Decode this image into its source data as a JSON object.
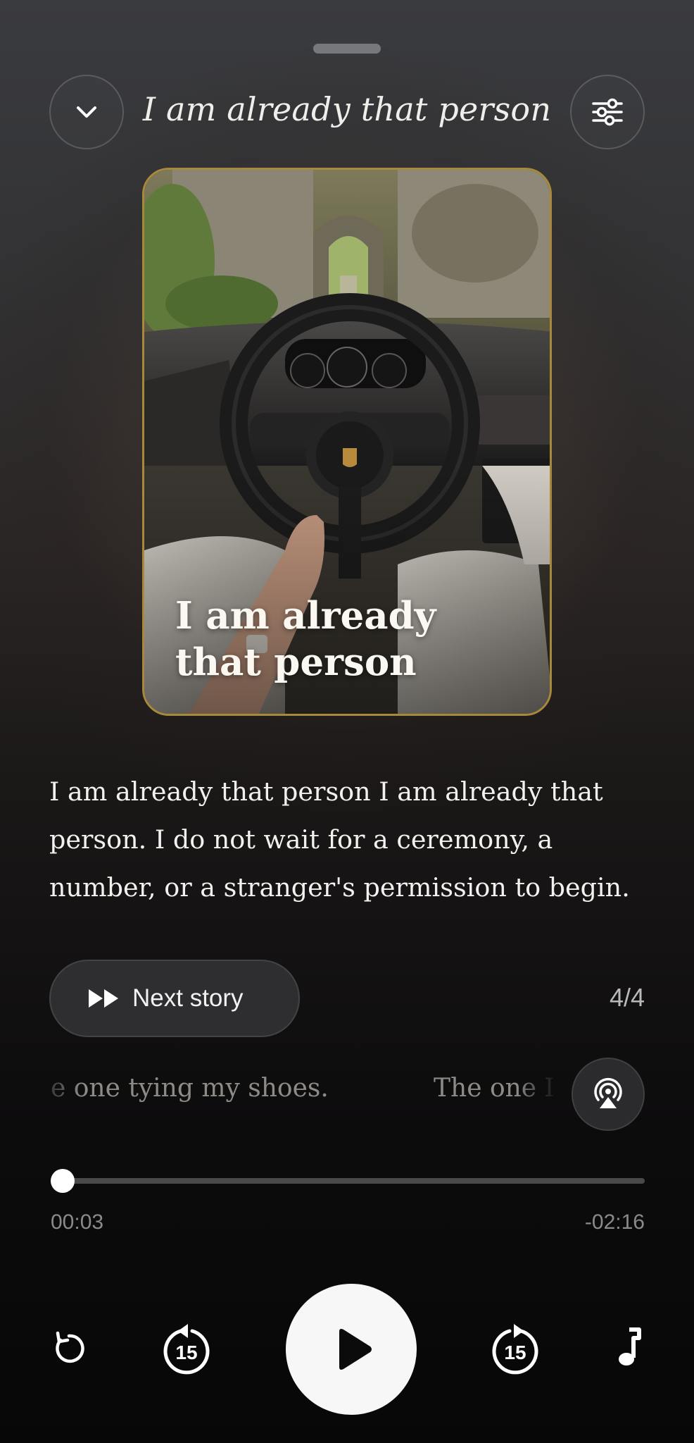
{
  "header": {
    "title": "I am already that person"
  },
  "cover": {
    "title_line1": "I am already",
    "title_line2": "that person",
    "border_color": "#a8883a"
  },
  "story": {
    "text": "I am already that person I am already that person. I do not wait for a ceremony, a number, or a stranger's permission to begin."
  },
  "next_story": {
    "label": "Next story"
  },
  "counter": "4/4",
  "ticker": {
    "segments": [
      "e one tying my shoes.",
      "The one I"
    ]
  },
  "playback": {
    "elapsed": "00:03",
    "remaining": "-02:16",
    "progress_fraction": 0.02
  },
  "controls": {
    "rewind_seconds": "15",
    "forward_seconds": "15"
  },
  "icons": {
    "collapse": "chevron-down-icon",
    "settings": "sliders-icon",
    "next": "fast-forward-icon",
    "airplay": "airplay-audio-icon",
    "replay": "replay-icon",
    "skip_back": "skip-back-15-icon",
    "play": "play-icon",
    "skip_forward": "skip-forward-15-icon",
    "music": "music-note-icon"
  }
}
